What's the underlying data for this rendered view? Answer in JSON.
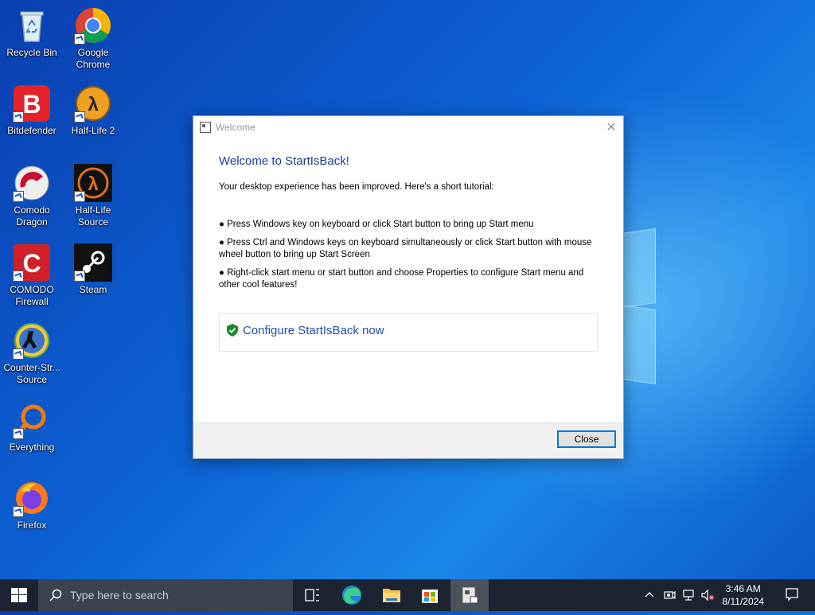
{
  "desktop": {
    "icons": [
      {
        "label": "Recycle Bin"
      },
      {
        "label": "Google Chrome"
      },
      {
        "label": "Bitdefender"
      },
      {
        "label": "Half-Life 2"
      },
      {
        "label": "Comodo Dragon"
      },
      {
        "label": "Half-Life Source"
      },
      {
        "label": "COMODO Firewall"
      },
      {
        "label": "Steam"
      },
      {
        "label": "Counter-Str... Source"
      },
      {
        "label": "Everything"
      },
      {
        "label": "Firefox"
      }
    ]
  },
  "dialog": {
    "title": "Welcome",
    "heading": "Welcome to StartIsBack!",
    "intro": "Your desktop experience has been improved. Here's a short tutorial:",
    "bullets": [
      "● Press Windows key on keyboard or click Start button to bring up Start menu",
      "● Press Ctrl and Windows keys on keyboard simultaneously or click Start button with mouse wheel button to bring up Start Screen",
      "● Right-click start menu or start button and choose Properties to configure Start menu and other cool features!"
    ],
    "configure_link": "Configure StartIsBack now",
    "close_button": "Close"
  },
  "taskbar": {
    "search_placeholder": "Type here to search",
    "time": "3:46 AM",
    "date": "8/11/2024"
  },
  "colors": {
    "accent": "#0078d7",
    "heading": "#1f3a93",
    "link": "#1f4eb0",
    "taskbar": "#1b2430"
  }
}
